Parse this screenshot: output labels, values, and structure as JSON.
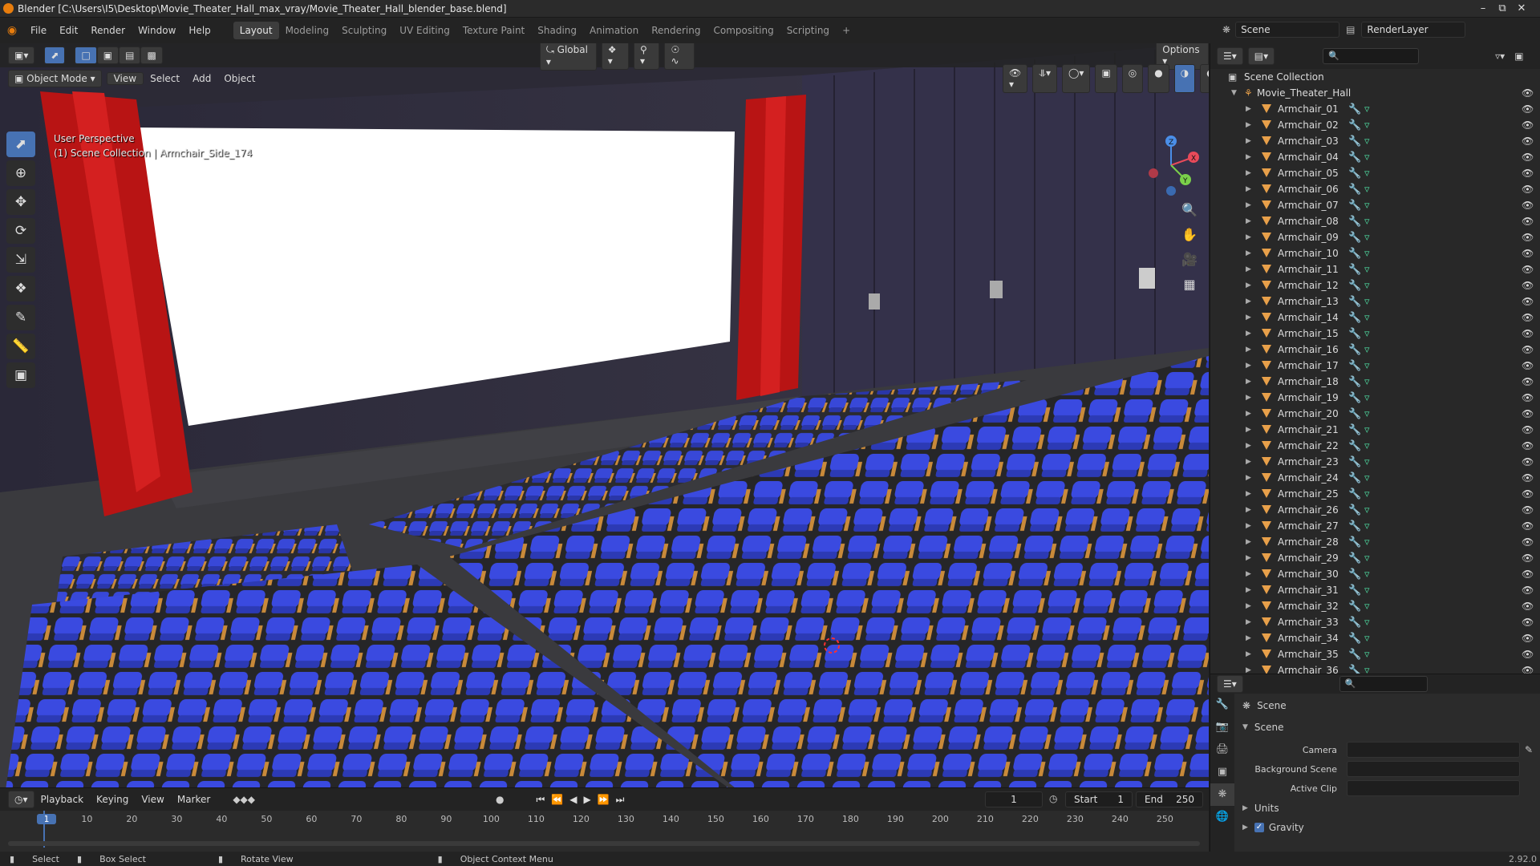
{
  "window": {
    "title": "Blender [C:\\Users\\I5\\Desktop\\Movie_Theater_Hall_max_vray/Movie_Theater_Hall_blender_base.blend]",
    "minimize": "–",
    "maximize": "⧉",
    "close": "✕"
  },
  "menu": [
    "File",
    "Edit",
    "Render",
    "Window",
    "Help"
  ],
  "workspaces": [
    {
      "label": "Layout",
      "active": true
    },
    {
      "label": "Modeling",
      "active": false
    },
    {
      "label": "Sculpting",
      "active": false
    },
    {
      "label": "UV Editing",
      "active": false
    },
    {
      "label": "Texture Paint",
      "active": false
    },
    {
      "label": "Shading",
      "active": false
    },
    {
      "label": "Animation",
      "active": false
    },
    {
      "label": "Rendering",
      "active": false
    },
    {
      "label": "Compositing",
      "active": false
    },
    {
      "label": "Scripting",
      "active": false
    }
  ],
  "scene_selector": {
    "label": "Scene"
  },
  "render_layer": {
    "label": "RenderLayer"
  },
  "viewport": {
    "orientation": "Global",
    "options": "Options",
    "mode": "Object Mode",
    "header_menus": [
      "View",
      "Select",
      "Add",
      "Object"
    ],
    "perspective": "User Perspective",
    "collection_info": "(1) Scene Collection | Armchair_Side_174"
  },
  "gizmo": {
    "x": "X",
    "y": "Y",
    "z": "Z"
  },
  "outliner": {
    "root": "Scene Collection",
    "collection": "Movie_Theater_Hall",
    "items": [
      "Armchair_01",
      "Armchair_02",
      "Armchair_03",
      "Armchair_04",
      "Armchair_05",
      "Armchair_06",
      "Armchair_07",
      "Armchair_08",
      "Armchair_09",
      "Armchair_10",
      "Armchair_11",
      "Armchair_12",
      "Armchair_13",
      "Armchair_14",
      "Armchair_15",
      "Armchair_16",
      "Armchair_17",
      "Armchair_18",
      "Armchair_19",
      "Armchair_20",
      "Armchair_21",
      "Armchair_22",
      "Armchair_23",
      "Armchair_24",
      "Armchair_25",
      "Armchair_26",
      "Armchair_27",
      "Armchair_28",
      "Armchair_29",
      "Armchair_30",
      "Armchair_31",
      "Armchair_32",
      "Armchair_33",
      "Armchair_34",
      "Armchair_35",
      "Armchair_36"
    ]
  },
  "properties": {
    "context": "Scene",
    "panel": "Scene",
    "camera_label": "Camera",
    "background_label": "Background Scene",
    "clip_label": "Active Clip",
    "units": "Units",
    "gravity": "Gravity",
    "gravity_checked": true
  },
  "timeline": {
    "menus": [
      "Playback",
      "Keying",
      "View",
      "Marker"
    ],
    "current_frame": "1",
    "start_label": "Start",
    "start": "1",
    "end_label": "End",
    "end": "250",
    "ruler": [
      "1",
      "10",
      "20",
      "30",
      "40",
      "50",
      "60",
      "70",
      "80",
      "90",
      "100",
      "110",
      "120",
      "130",
      "140",
      "150",
      "160",
      "170",
      "180",
      "190",
      "200",
      "210",
      "220",
      "230",
      "240",
      "250"
    ]
  },
  "statusbar": {
    "select": "Select",
    "box_select": "Box Select",
    "rotate": "Rotate View",
    "context_menu": "Object Context Menu",
    "version": "2.92.0"
  },
  "colors": {
    "accent": "#4772b3",
    "seat": "#3344cc",
    "curtain": "#c01818",
    "screen": "#ffffff"
  }
}
